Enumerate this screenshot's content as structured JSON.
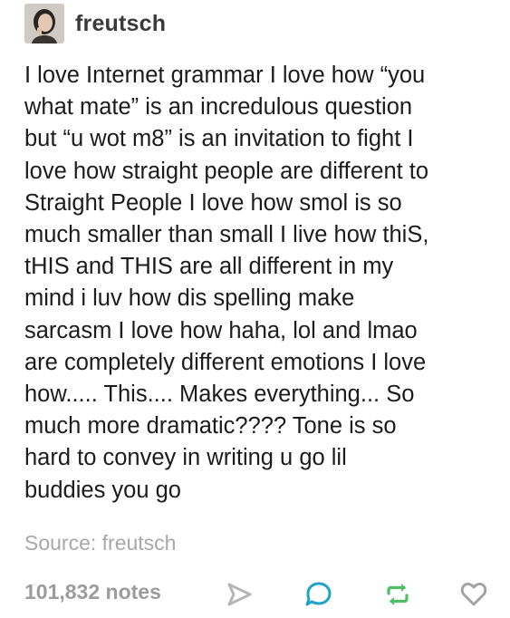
{
  "post": {
    "username": "freutsch",
    "avatar_icon": "user-avatar-photo",
    "body_lines": [
      "I love Internet grammar I love how “you",
      "what mate” is an incredulous question",
      "but “u wot m8” is an invitation to fight I",
      "love how straight people are different to",
      "Straight People I love how smol is so",
      "much smaller than small I live how thiS,",
      "tHIS and THIS are all different in my",
      "mind i luv how dis spelling make",
      "sarcasm I love how haha, lol and lmao",
      "are completely different emotions I love",
      "how..... This.... Makes everything... So",
      "much more dramatic???? Tone is so",
      "hard to convey in writing u go lil",
      "buddies you go"
    ],
    "source_label": "Source:",
    "source_name": "freutsch"
  },
  "footer": {
    "notes": "101,832 notes",
    "icons": [
      "share-icon",
      "reply-icon",
      "reblog-icon",
      "like-icon"
    ],
    "colors": {
      "share": "#b5b5b5",
      "reply": "#1fa3c8",
      "reblog": "#4cbf67",
      "like": "#a3a3a3"
    }
  }
}
